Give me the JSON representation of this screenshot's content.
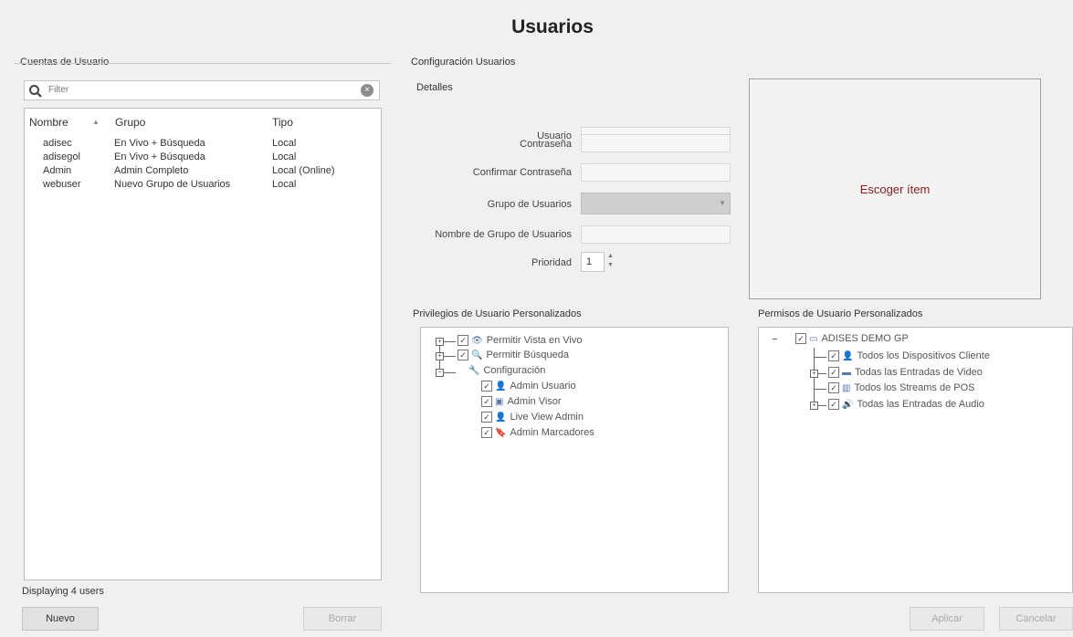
{
  "title": "Usuarios",
  "left_panel": {
    "group_label": "Cuentas de Usuario",
    "search": {
      "value": "Filter",
      "clear": "×"
    },
    "columns": {
      "name": "Nombre",
      "sort_indicator": "▲",
      "group": "Grupo",
      "type": "Tipo"
    },
    "users": [
      {
        "name": "adisec",
        "group": "En Vivo + Búsqueda",
        "type": "Local"
      },
      {
        "name": "adisegol",
        "group": "En Vivo + Búsqueda",
        "type": "Local"
      },
      {
        "name": "Admin",
        "group": "Admin Completo",
        "type": "Local (Online)"
      },
      {
        "name": "webuser",
        "group": "Nuevo Grupo de Usuarios",
        "type": "Local"
      }
    ],
    "status": "Displaying 4 users",
    "new_button": "Nuevo",
    "delete_button": "Borrar"
  },
  "config": {
    "group_label": "Configuración Usuarios",
    "details_label": "Detalles",
    "fields": {
      "user": "Usuario",
      "password": "Contraseña",
      "confirm": "Confirmar Contraseña",
      "user_group": "Grupo de Usuarios",
      "group_name": "Nombre de Grupo de Usuarios",
      "priority": "Prioridad"
    },
    "priority_value": "1",
    "picker_text": "Escoger ítem"
  },
  "privileges": {
    "label": "Privilegios de Usuario Personalizados",
    "items": [
      {
        "label": "Permitir Vista en Vivo",
        "icon": "eye-icon",
        "level": 0,
        "expander": "+"
      },
      {
        "label": "Permitir Búsqueda",
        "icon": "search-icon",
        "level": 0,
        "expander": "+"
      },
      {
        "label": "Configuración",
        "icon": "wrench-icon",
        "level": 0,
        "expander": "−"
      },
      {
        "label": "Admin Usuario",
        "icon": "user-icon",
        "level": 1
      },
      {
        "label": "Admin Visor",
        "icon": "monitor-icon",
        "level": 1
      },
      {
        "label": "Live View Admin",
        "icon": "user-icon",
        "level": 1
      },
      {
        "label": "Admin Marcadores",
        "icon": "bookmark-icon",
        "level": 1
      }
    ]
  },
  "permissions": {
    "label": "Permisos de Usuario Personalizados",
    "root": {
      "label": "ADISES DEMO GP",
      "expander": "−"
    },
    "items": [
      {
        "label": "Todos los Dispositivos Cliente",
        "icon": "user-icon",
        "expander": ""
      },
      {
        "label": "Todas las Entradas de Video",
        "icon": "camera-icon",
        "expander": "+"
      },
      {
        "label": "Todos los Streams de POS",
        "icon": "pos-icon",
        "expander": ""
      },
      {
        "label": "Todas las Entradas de Audio",
        "icon": "audio-icon",
        "expander": "+"
      }
    ]
  },
  "footer": {
    "apply": "Aplicar",
    "cancel": "Cancelar"
  }
}
